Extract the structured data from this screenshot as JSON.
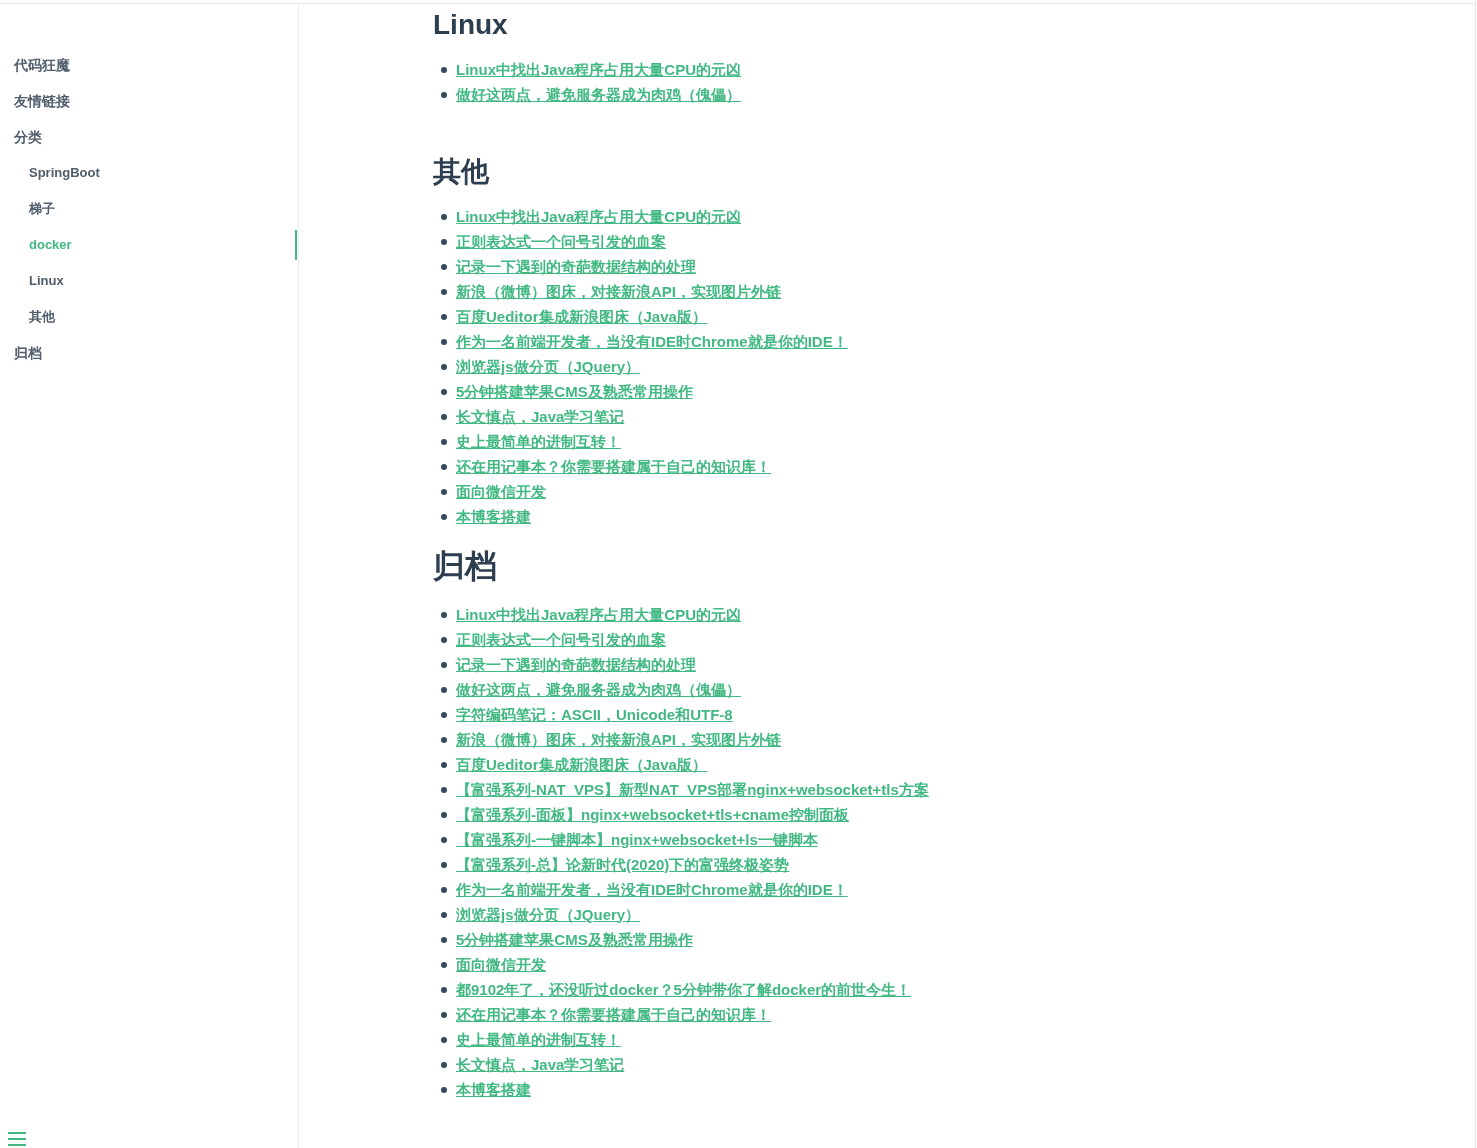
{
  "sidebar": {
    "items": [
      {
        "label": "代码狂魔",
        "selected": false
      },
      {
        "label": "友情链接",
        "selected": false
      },
      {
        "label": "分类",
        "selected": false,
        "children": [
          {
            "label": "SpringBoot",
            "selected": false
          },
          {
            "label": "梯子",
            "selected": false
          },
          {
            "label": "docker",
            "selected": true
          },
          {
            "label": "Linux",
            "selected": false
          },
          {
            "label": "其他",
            "selected": false
          }
        ]
      },
      {
        "label": "归档",
        "selected": false
      }
    ]
  },
  "sections": [
    {
      "kind": "h2",
      "title": "Linux",
      "links": [
        "Linux中找出Java程序占用大量CPU的元凶",
        "做好这两点，避免服务器成为肉鸡（傀儡）"
      ]
    },
    {
      "kind": "h2",
      "title": "其他",
      "links": [
        "Linux中找出Java程序占用大量CPU的元凶",
        "正则表达式一个问号引发的血案",
        "记录一下遇到的奇葩数据结构的处理",
        "新浪（微博）图床，对接新浪API，实现图片外链",
        "百度Ueditor集成新浪图床（Java版）",
        "作为一名前端开发者，当没有IDE时Chrome就是你的IDE！",
        "浏览器js做分页（JQuery）",
        "5分钟搭建苹果CMS及熟悉常用操作",
        "长文慎点，Java学习笔记",
        "史上最简单的进制互转！",
        "还在用记事本？你需要搭建属于自己的知识库！",
        "面向微信开发",
        "本博客搭建"
      ]
    },
    {
      "kind": "h1",
      "title": "归档",
      "links": [
        "Linux中找出Java程序占用大量CPU的元凶",
        "正则表达式一个问号引发的血案",
        "记录一下遇到的奇葩数据结构的处理",
        "做好这两点，避免服务器成为肉鸡（傀儡）",
        "字符编码笔记：ASCII，Unicode和UTF-8",
        "新浪（微博）图床，对接新浪API，实现图片外链",
        "百度Ueditor集成新浪图床（Java版）",
        "【富强系列-NAT_VPS】新型NAT_VPS部署nginx+websocket+tls方案",
        "【富强系列-面板】nginx+websocket+tls+cname控制面板",
        "【富强系列-一键脚本】nginx+websocket+ls一键脚本",
        "【富强系列-总】论新时代(2020)下的富强终极姿势",
        "作为一名前端开发者，当没有IDE时Chrome就是你的IDE！",
        "浏览器js做分页（JQuery）",
        "5分钟搭建苹果CMS及熟悉常用操作",
        "面向微信开发",
        "都9102年了，还没听过docker？5分钟带你了解docker的前世今生！",
        "还在用记事本？你需要搭建属于自己的知识库！",
        "史上最简单的进制互转！",
        "长文慎点，Java学习笔记",
        "本博客搭建"
      ]
    }
  ]
}
